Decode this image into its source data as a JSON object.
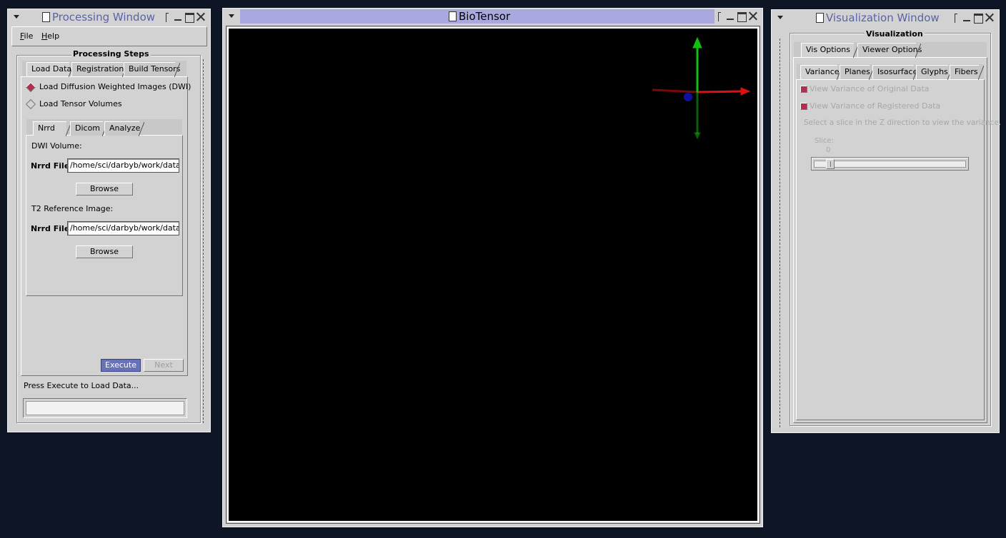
{
  "processing_window": {
    "title": "Processing Window",
    "menu": {
      "file": "File",
      "help": "Help"
    },
    "steps_label": "Processing Steps",
    "tabs": [
      "Load Data",
      "Registration",
      "Build Tensors"
    ],
    "radios": [
      {
        "label": "Load Diffusion Weighted Images (DWI)",
        "selected": true
      },
      {
        "label": "Load Tensor Volumes",
        "selected": false
      }
    ],
    "format_tabs": [
      "Nrrd",
      "Dicom",
      "Analyze"
    ],
    "dwi_label": "DWI Volume:",
    "nrrd_file_label": "Nrrd File:",
    "dwi_path": "/home/sci/darbyb/work/data",
    "browse": "Browse",
    "t2_label": "T2 Reference Image:",
    "t2_path": "/home/sci/darbyb/work/data",
    "execute": "Execute",
    "next": "Next",
    "status": "Press Execute to Load Data...",
    "progress": 0
  },
  "viewer_window": {
    "title": "BioTensor",
    "axis_colors": {
      "x": "#e01010",
      "y": "#10c010",
      "z": "#1010a0"
    }
  },
  "vis_window": {
    "title": "Visualization Window",
    "frame_label": "Visualization",
    "tabs": [
      "Vis Options",
      "Viewer Options"
    ],
    "sub_tabs": [
      "Variance",
      "Planes",
      "Isosurface",
      "Glyphs",
      "Fibers"
    ],
    "check_original": "View Variance of Original Data",
    "check_registered": "View Variance of Registered Data",
    "hint": "Select a slice in the Z direction to view the variance.",
    "slice_label": "Slice:",
    "slice_value": "0"
  }
}
